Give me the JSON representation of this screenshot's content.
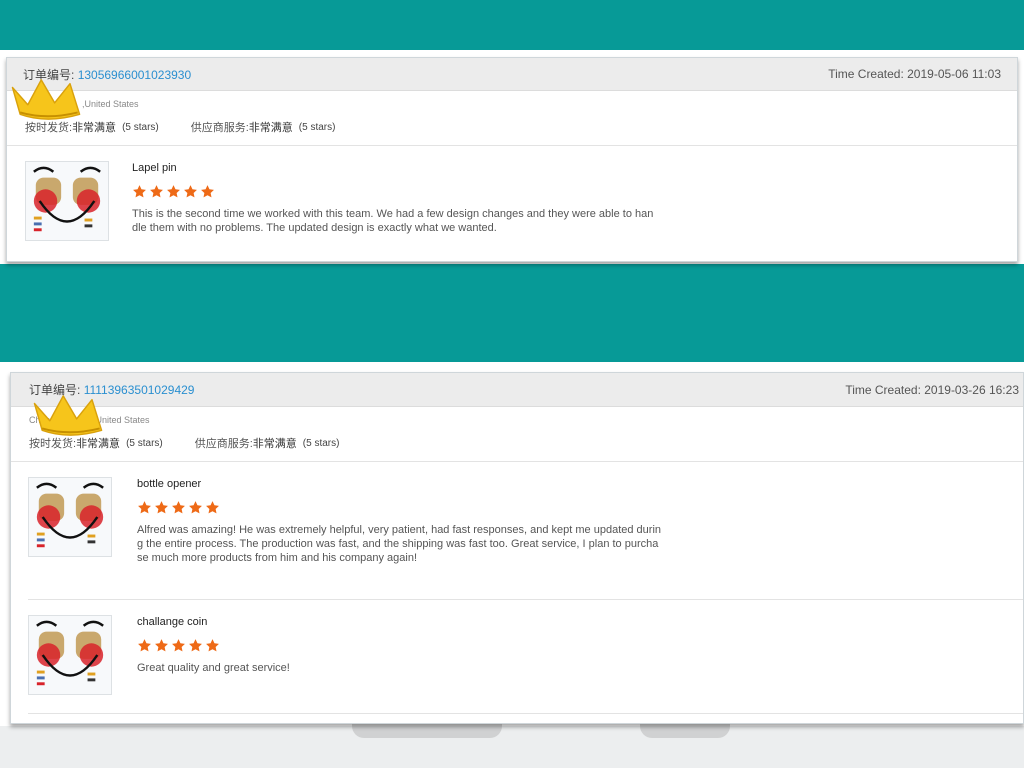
{
  "colors": {
    "teal": "#079a97",
    "star": "#ee6a17",
    "link": "#2a8fd0"
  },
  "reviews": [
    {
      "order_label": "订单编号:",
      "order_number": "13056966001023930",
      "time_created": "Time Created: 2019-05-06 11:03",
      "buyer_location": ",United States",
      "on_time_label": "按时发货:",
      "on_time_value": "非常满意",
      "on_time_stars": "(5 stars)",
      "supplier_label": "供应商服务:",
      "supplier_value": "非常满意",
      "supplier_stars": "(5 stars)",
      "items": [
        {
          "title": "Lapel pin",
          "rating": 5,
          "lines": [
            "This is the second time we worked with this team.  We had a few design changes and they were able to han",
            "dle them with no problems. The updated design is exactly what we wanted."
          ]
        }
      ]
    },
    {
      "order_label": "订单编号:",
      "order_number": "11113963501029429",
      "time_created": "Time Created: 2019-03-26 16:23",
      "buyer_location": "Chris            isic,United States",
      "on_time_label": "按时发货:",
      "on_time_value": "非常满意",
      "on_time_stars": "(5 stars)",
      "supplier_label": "供应商服务:",
      "supplier_value": "非常满意",
      "supplier_stars": "(5 stars)",
      "items": [
        {
          "title": "bottle opener",
          "rating": 5,
          "lines": [
            "Alfred was amazing! He was extremely helpful, very patient, had fast responses, and kept me updated durin",
            "g the entire process. The production was fast, and the shipping was fast too. Great service, I plan to purcha",
            "se much more products from him and his company again!"
          ]
        },
        {
          "title": "challange coin",
          "rating": 5,
          "lines": [
            "Great quality and great service!"
          ]
        }
      ]
    }
  ]
}
